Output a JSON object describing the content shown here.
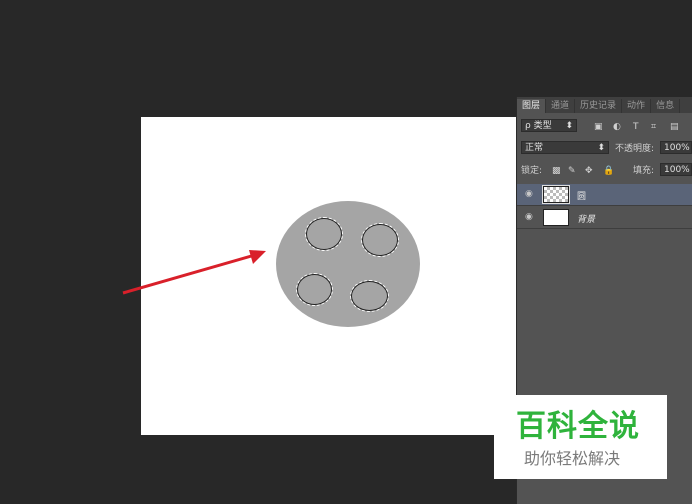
{
  "panel": {
    "tabs": [
      {
        "label": "图层"
      },
      {
        "label": "通道"
      },
      {
        "label": "历史记录"
      },
      {
        "label": "动作"
      },
      {
        "label": "信息"
      }
    ],
    "filter": {
      "search_glyph": "ρ",
      "kind_label": "类型"
    },
    "blend_mode": "正常",
    "opacity": {
      "label": "不透明度:",
      "value": "100%"
    },
    "lock": {
      "label": "锁定:"
    },
    "fill": {
      "label": "填充:",
      "value": "100%"
    },
    "layers": [
      {
        "name": "圆",
        "visible": true,
        "selected": true
      },
      {
        "name": "背景",
        "visible": true,
        "selected": false
      }
    ]
  },
  "watermark": {
    "title": "百科全说",
    "subtitle": "助你轻松解决"
  },
  "colors": {
    "workspace": "#282828",
    "ellipse_fill": "#a5a5a5",
    "arrow": "#d9202a",
    "watermark_green": "#2fb33c"
  },
  "icons": [
    "eye-icon",
    "search-icon",
    "image-filter-icon",
    "circle-filter-icon",
    "text-filter-icon",
    "transform-filter-icon",
    "smart-object-filter-icon",
    "lock-pixels-icon",
    "lock-brush-icon",
    "lock-move-icon",
    "lock-all-icon"
  ]
}
